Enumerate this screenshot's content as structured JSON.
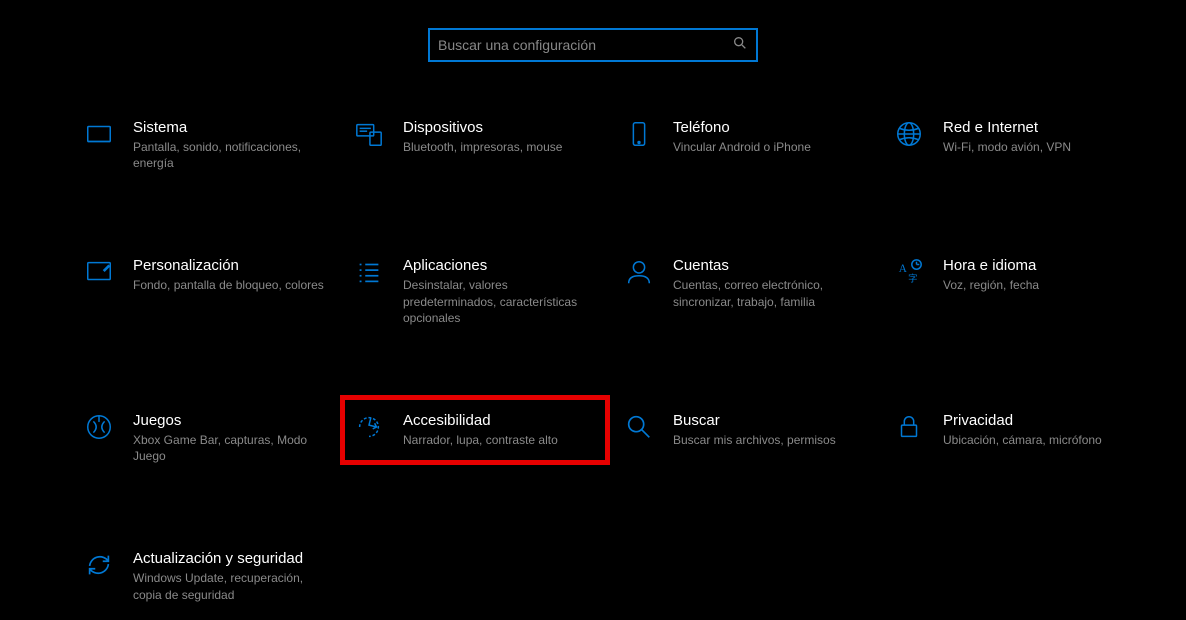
{
  "search": {
    "placeholder": "Buscar una configuración"
  },
  "tiles": {
    "sistema": {
      "title": "Sistema",
      "desc": "Pantalla, sonido, notificaciones, energía"
    },
    "dispositivos": {
      "title": "Dispositivos",
      "desc": "Bluetooth, impresoras, mouse"
    },
    "telefono": {
      "title": "Teléfono",
      "desc": "Vincular Android o iPhone"
    },
    "red": {
      "title": "Red e Internet",
      "desc": "Wi-Fi, modo avión, VPN"
    },
    "personalizacion": {
      "title": "Personalización",
      "desc": "Fondo, pantalla de bloqueo, colores"
    },
    "aplicaciones": {
      "title": "Aplicaciones",
      "desc": "Desinstalar, valores predeterminados, características opcionales"
    },
    "cuentas": {
      "title": "Cuentas",
      "desc": "Cuentas, correo electrónico, sincronizar, trabajo, familia"
    },
    "hora": {
      "title": "Hora e idioma",
      "desc": "Voz, región, fecha"
    },
    "juegos": {
      "title": "Juegos",
      "desc": "Xbox Game Bar, capturas, Modo Juego"
    },
    "accesibilidad": {
      "title": "Accesibilidad",
      "desc": "Narrador, lupa, contraste alto"
    },
    "buscar": {
      "title": "Buscar",
      "desc": "Buscar mis archivos, permisos"
    },
    "privacidad": {
      "title": "Privacidad",
      "desc": "Ubicación, cámara, micrófono"
    },
    "actualizacion": {
      "title": "Actualización y seguridad",
      "desc": "Windows Update, recuperación, copia de seguridad"
    }
  },
  "colors": {
    "accent": "#0078d4",
    "highlight": "#e60000"
  }
}
